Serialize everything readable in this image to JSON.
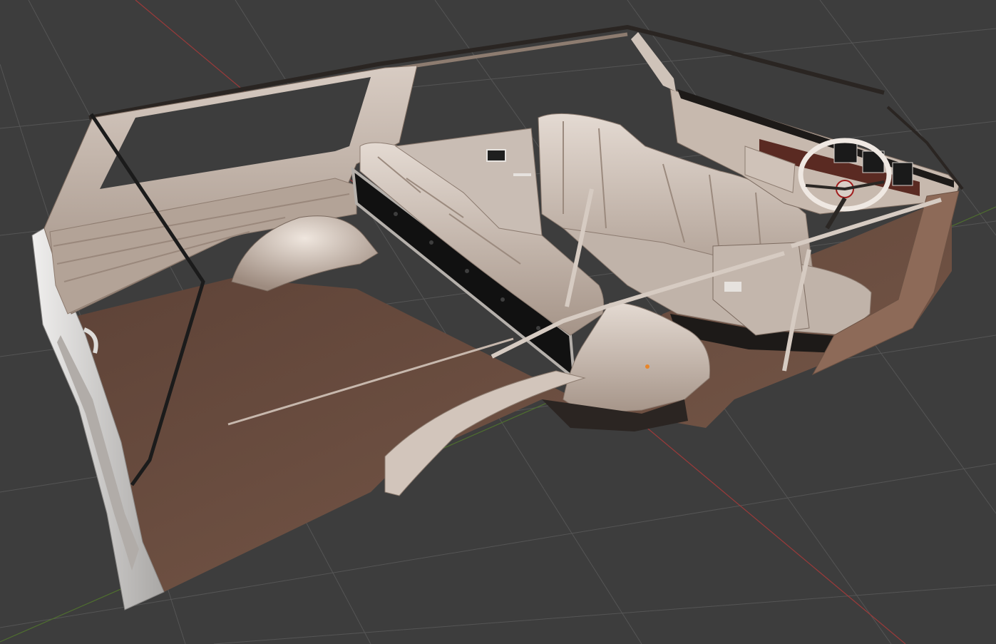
{
  "viewport": {
    "background_color": "#3d3d3d",
    "grid_color": "#555555",
    "axis_x_color": "#9c3a3a",
    "axis_y_color": "#4f6f2f",
    "origin_marker_color": "#e8862a"
  },
  "model": {
    "floor_color": "#6a4e40",
    "upholstery_color": "#c9bcb1",
    "body_color": "#cfcdca",
    "trim_color": "#1a1a1a",
    "interior_panel_color": "#b8a99d"
  }
}
